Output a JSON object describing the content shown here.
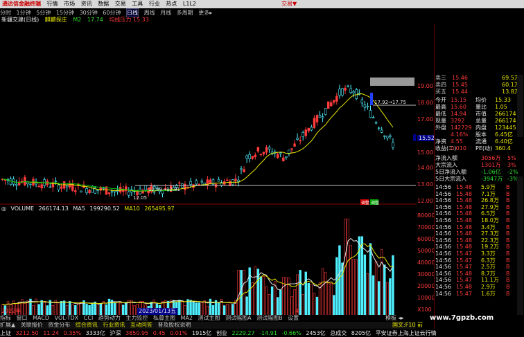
{
  "app": {
    "logo_text": "通达信金融终端",
    "menu": [
      "行情",
      "市场",
      "资讯",
      "数据",
      "交易",
      "工具",
      "行业",
      "热点",
      "L1L2"
    ],
    "brand": "交易▼"
  },
  "tabs": [
    "分时",
    "1分钟",
    "5分钟",
    "15分钟",
    "30分钟",
    "60分钟",
    "日线",
    "周线",
    "月线",
    "多周期",
    "更多▸"
  ],
  "active_tab": "日线",
  "chart_header": {
    "name": "新疆交建(日线)",
    "indicator": "麒麟探庄",
    "m2_label": "M2",
    "m2_value": "17.74",
    "extra": "均线压力 15.33"
  },
  "price_axis": [
    "19.00",
    "18.00",
    "17.00",
    "16.00",
    "15.00",
    "14.00",
    "13.00",
    "12.00"
  ],
  "chart_annotations": {
    "top_range": "17.92→17.75",
    "bottom_range": "12.89→12.81",
    "low_mark": "12.05",
    "current_price_tag": "15.52",
    "event_marks": [
      "调整",
      "调整"
    ]
  },
  "vol_header": {
    "label": "VOLUME",
    "value": "266174.13",
    "ma5_label": "MA5",
    "ma5": "199290.52",
    "ma10_label": "MA10",
    "ma10": "265495.97"
  },
  "vol_axis": [
    "80000",
    "70000",
    "60000",
    "50000",
    "40000",
    "30000",
    "20000",
    "10000"
  ],
  "vol_axis_unit": "X100",
  "date_axis": {
    "left": "2022年",
    "middle": "2023/01/13五",
    "marker": "4"
  },
  "indicator_tabs": [
    "指标",
    "窗口",
    "MACD",
    "VOL-TDX",
    "CCI",
    "趋势动力",
    "主力监控",
    "私募主图",
    "MA2",
    "测试主图",
    "测试幅图A",
    "测试幅图B",
    "设置"
  ],
  "indicator_tabs_right": "模板 ◂▸",
  "bottom_tabs": [
    "扩展▲",
    "关联报价",
    "资金分布",
    "综合资讯",
    "行业资讯",
    "互动问答",
    "普及股权说明"
  ],
  "bottom_tabs_right": "国文:F10 前",
  "quote_panel": {
    "asks": [
      {
        "label": "卖三",
        "price": "15.46",
        "vol": "69.5万"
      },
      {
        "label": "卖四",
        "price": "15.45",
        "vol": "60.1万"
      },
      {
        "label": "买五",
        "price": "15.44",
        "vol": "13.8万"
      }
    ],
    "stats": [
      {
        "l1": "今开",
        "v1": "15.15",
        "l2": "均价",
        "v2": "15.33"
      },
      {
        "l1": "最高",
        "v1": "15.60",
        "l2": "量比",
        "v2": "1.05"
      },
      {
        "l1": "最低",
        "v1": "14.94",
        "l2": "市值",
        "v2": "266174"
      },
      {
        "l1": "现量",
        "v1": "3292",
        "l2": "总量",
        "v2": "266174"
      },
      {
        "l1": "外盘",
        "v1": "142729",
        "l2": "内盘",
        "v2": "123445"
      },
      {
        "l1": "",
        "v1": "4.16%",
        "l2": "股本",
        "v2": "6.45亿"
      },
      {
        "l1": "净资",
        "v1": "4.55",
        "l2": "流通",
        "v2": "6.40亿"
      },
      {
        "l1": "收益(二)",
        "v1": "0.010",
        "l2": "PE(动)",
        "v2": "360.4"
      }
    ],
    "flows": [
      {
        "label": "净流入额",
        "value": "3056万",
        "pct": "5%"
      },
      {
        "label": "大宗流入",
        "value": "1301万",
        "pct": "3%"
      },
      {
        "label": "5日净流入额",
        "value": "-1.06亿",
        "pct": "-2%"
      },
      {
        "label": "5日大宗流入",
        "value": "-3947万",
        "pct": "-3%"
      }
    ],
    "trades": [
      {
        "t": "14:56",
        "p": "15.48",
        "v": "5.9万",
        "d": "B"
      },
      {
        "t": "14:56",
        "p": "15.48",
        "v": "7.1万",
        "d": "B"
      },
      {
        "t": "14:56",
        "p": "15.48",
        "v": "26.8万",
        "d": "B"
      },
      {
        "t": "14:56",
        "p": "15.48",
        "v": "27.9万",
        "d": "B"
      },
      {
        "t": "14:56",
        "p": "15.48",
        "v": "6.5万",
        "d": "B"
      },
      {
        "t": "14:56",
        "p": "15.48",
        "v": "18.0万",
        "d": "B"
      },
      {
        "t": "14:56",
        "p": "15.48",
        "v": "3.4万",
        "d": "B"
      },
      {
        "t": "14:56",
        "p": "15.48",
        "v": "27.3万",
        "d": "B"
      },
      {
        "t": "14:56",
        "p": "15.48",
        "v": "22.3万",
        "d": "B"
      },
      {
        "t": "14:56",
        "p": "15.48",
        "v": "19.2万",
        "d": "B"
      },
      {
        "t": "14:56",
        "p": "15.47",
        "v": "3.3万",
        "d": "B"
      },
      {
        "t": "14:56",
        "p": "15.47",
        "v": "6.3万",
        "d": "B"
      },
      {
        "t": "14:56",
        "p": "15.47",
        "v": "2.5万",
        "d": "B"
      },
      {
        "t": "14:56",
        "p": "15.48",
        "v": "8.7万",
        "d": "B"
      },
      {
        "t": "14:56",
        "p": "15.47",
        "v": "11.1万",
        "d": "B"
      },
      {
        "t": "14:56",
        "p": "15.48",
        "v": "2.9万",
        "d": "B"
      },
      {
        "t": "14:56",
        "p": "15.47",
        "v": "1.6万",
        "d": "B"
      }
    ]
  },
  "status_bar": [
    {
      "label": "上证",
      "value": "3212.50",
      "chg": "11.24",
      "pct": "0.35%",
      "amt": "3333亿"
    },
    {
      "label": "沪深",
      "value": "3850.95",
      "chg": "0.45",
      "pct": "0.01%",
      "amt": "1915亿"
    },
    {
      "label": "创业",
      "value": "2229.27",
      "chg": "-14.91",
      "pct": "-0.66%",
      "amt": "2453亿"
    }
  ],
  "status_extra": {
    "label": "总成交",
    "value": "8205亿",
    "notice": "平安证券上海上证云行情"
  },
  "watermark": "www.7gpzb.com",
  "colors": {
    "up": "#ff3b3b",
    "down": "#4ff0ff",
    "ma": "#e8e800",
    "bg": "#000000"
  }
}
